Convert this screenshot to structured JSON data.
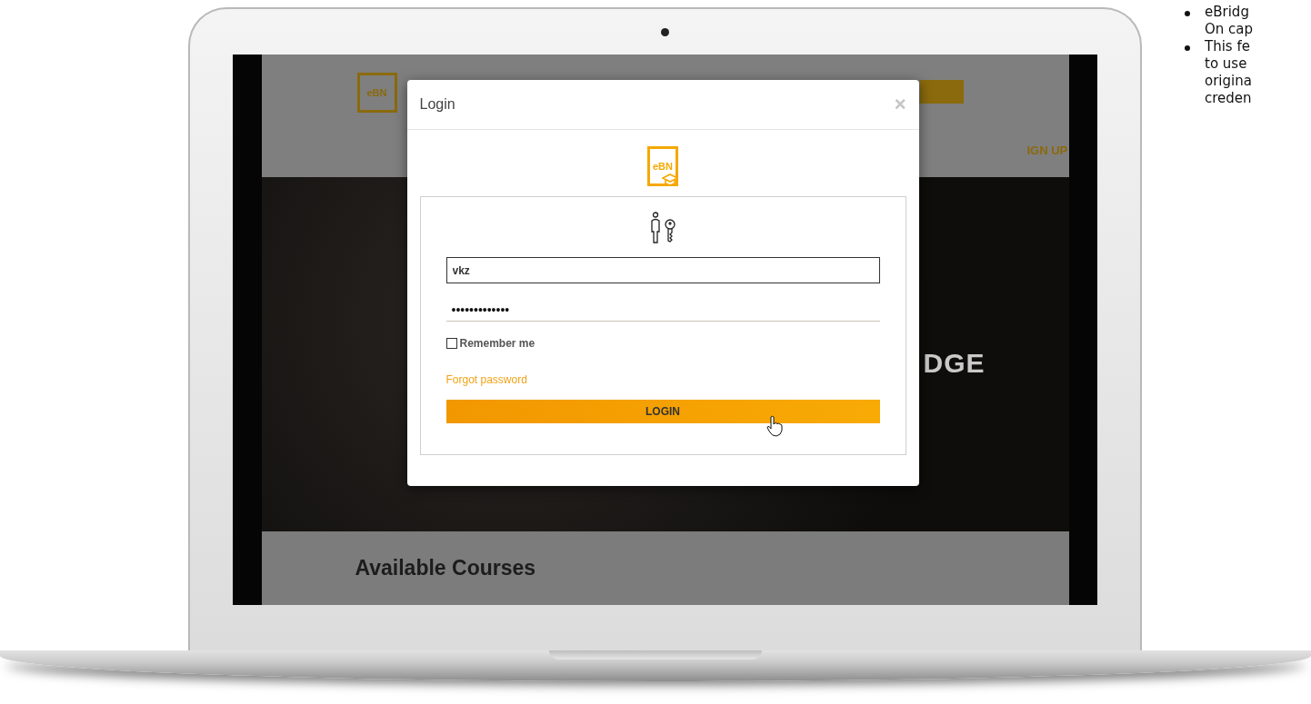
{
  "notes": [
    {
      "lines": [
        "eBridg",
        "On cap"
      ]
    },
    {
      "lines": [
        "This fe",
        "to use",
        "origina",
        "creden"
      ]
    }
  ],
  "site": {
    "logo": "eBN",
    "signup": "IGN UP",
    "hero_text": "DGE",
    "section_title": "Available Courses"
  },
  "modal": {
    "title": "Login",
    "close": "×",
    "logo": "eBN",
    "username": "vkz",
    "password": "•••••••••••••",
    "remember": {
      "label": "Remember me",
      "checked": false
    },
    "forgot": "Forgot password",
    "button": "LOGIN"
  }
}
